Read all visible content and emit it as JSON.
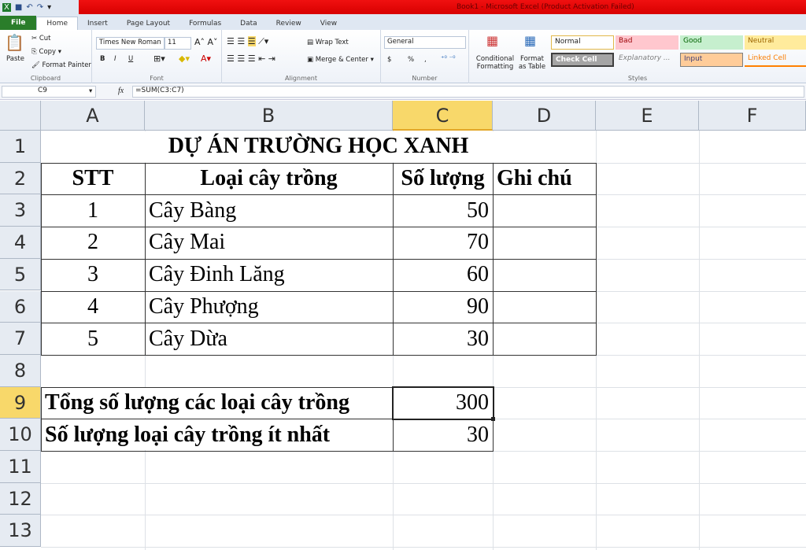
{
  "window": {
    "title": "Book1  -  Microsoft Excel (Product Activation Failed)"
  },
  "tabs": [
    "File",
    "Home",
    "Insert",
    "Page Layout",
    "Formulas",
    "Data",
    "Review",
    "View"
  ],
  "ribbon": {
    "clipboard": {
      "paste": "Paste",
      "cut": "Cut",
      "copy": "Copy",
      "format_painter": "Format Painter",
      "label": "Clipboard"
    },
    "font": {
      "name": "Times New Roman",
      "size": "11",
      "label": "Font",
      "bold": "B",
      "italic": "I",
      "underline": "U"
    },
    "alignment": {
      "wrap": "Wrap Text",
      "merge": "Merge & Center",
      "label": "Alignment"
    },
    "number": {
      "format": "General",
      "currency": "$",
      "percent": "%",
      "comma": ",",
      "label": "Number"
    },
    "styles": {
      "conditional": "Conditional Formatting",
      "format_table": "Format as Table",
      "label": "Styles",
      "items": [
        {
          "name": "Normal",
          "bg": "#ffffff"
        },
        {
          "name": "Bad",
          "bg": "#ffc7ce"
        },
        {
          "name": "Good",
          "bg": "#c6efce"
        },
        {
          "name": "Neutral",
          "bg": "#ffeb9c"
        },
        {
          "name": "Check Cell",
          "bg": "#a5a5a5"
        },
        {
          "name": "Explanatory ...",
          "bg": "#ffffff"
        },
        {
          "name": "Input",
          "bg": "#ffcc99"
        },
        {
          "name": "Linked Cell",
          "bg": "#ffffff"
        }
      ]
    }
  },
  "formula_bar": {
    "name_box": "C9",
    "fx": "fx",
    "formula": "=SUM(C3:C7)"
  },
  "columns": [
    "A",
    "B",
    "C",
    "D",
    "E",
    "F"
  ],
  "rows": [
    "1",
    "2",
    "3",
    "4",
    "5",
    "6",
    "7",
    "8",
    "9",
    "10",
    "11",
    "12",
    "13"
  ],
  "sheet": {
    "title": "DỰ ÁN TRƯỜNG HỌC XANH",
    "headers": [
      "STT",
      "Loại cây trồng",
      "Số lượng",
      "Ghi chú"
    ],
    "data": [
      [
        "1",
        "Cây Bàng",
        "50",
        ""
      ],
      [
        "2",
        "Cây Mai",
        "70",
        ""
      ],
      [
        "3",
        "Cây Đinh Lăng",
        "60",
        ""
      ],
      [
        "4",
        "Cây Phượng",
        "90",
        ""
      ],
      [
        "5",
        "Cây Dừa",
        "30",
        ""
      ]
    ],
    "total_label": "Tổng số lượng các loại cây trồng",
    "total_value": "300",
    "min_label": "Số lượng loại cây trồng ít nhất",
    "min_value": "30"
  }
}
